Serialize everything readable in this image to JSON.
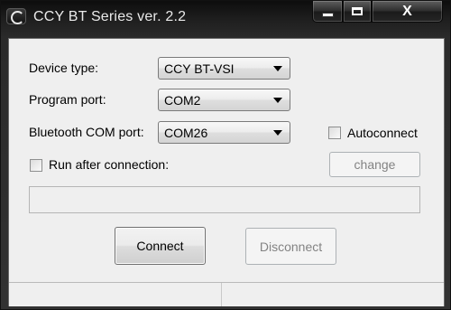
{
  "window": {
    "title": "CCY BT Series ver. 2.2",
    "icons": {
      "app": "ccy-logo-icon",
      "minimize": "minimize-icon",
      "maximize": "maximize-icon",
      "close": "close-icon"
    },
    "close_glyph": "X"
  },
  "form": {
    "device_type": {
      "label": "Device type:",
      "value": "CCY BT-VSI"
    },
    "program_port": {
      "label": "Program port:",
      "value": "COM2"
    },
    "bluetooth_port": {
      "label": "Bluetooth COM port:",
      "value": "COM26"
    },
    "autoconnect": {
      "label": "Autoconnect",
      "checked": false
    },
    "run_after": {
      "label": "Run after connection:",
      "checked": false
    },
    "change_label": "change",
    "status_text": ""
  },
  "actions": {
    "connect_label": "Connect",
    "disconnect_label": "Disconnect"
  },
  "statusbar": {
    "left_text": "",
    "right_text": ""
  },
  "colors": {
    "client_bg": "#efefef",
    "disabled_text": "#838383"
  }
}
